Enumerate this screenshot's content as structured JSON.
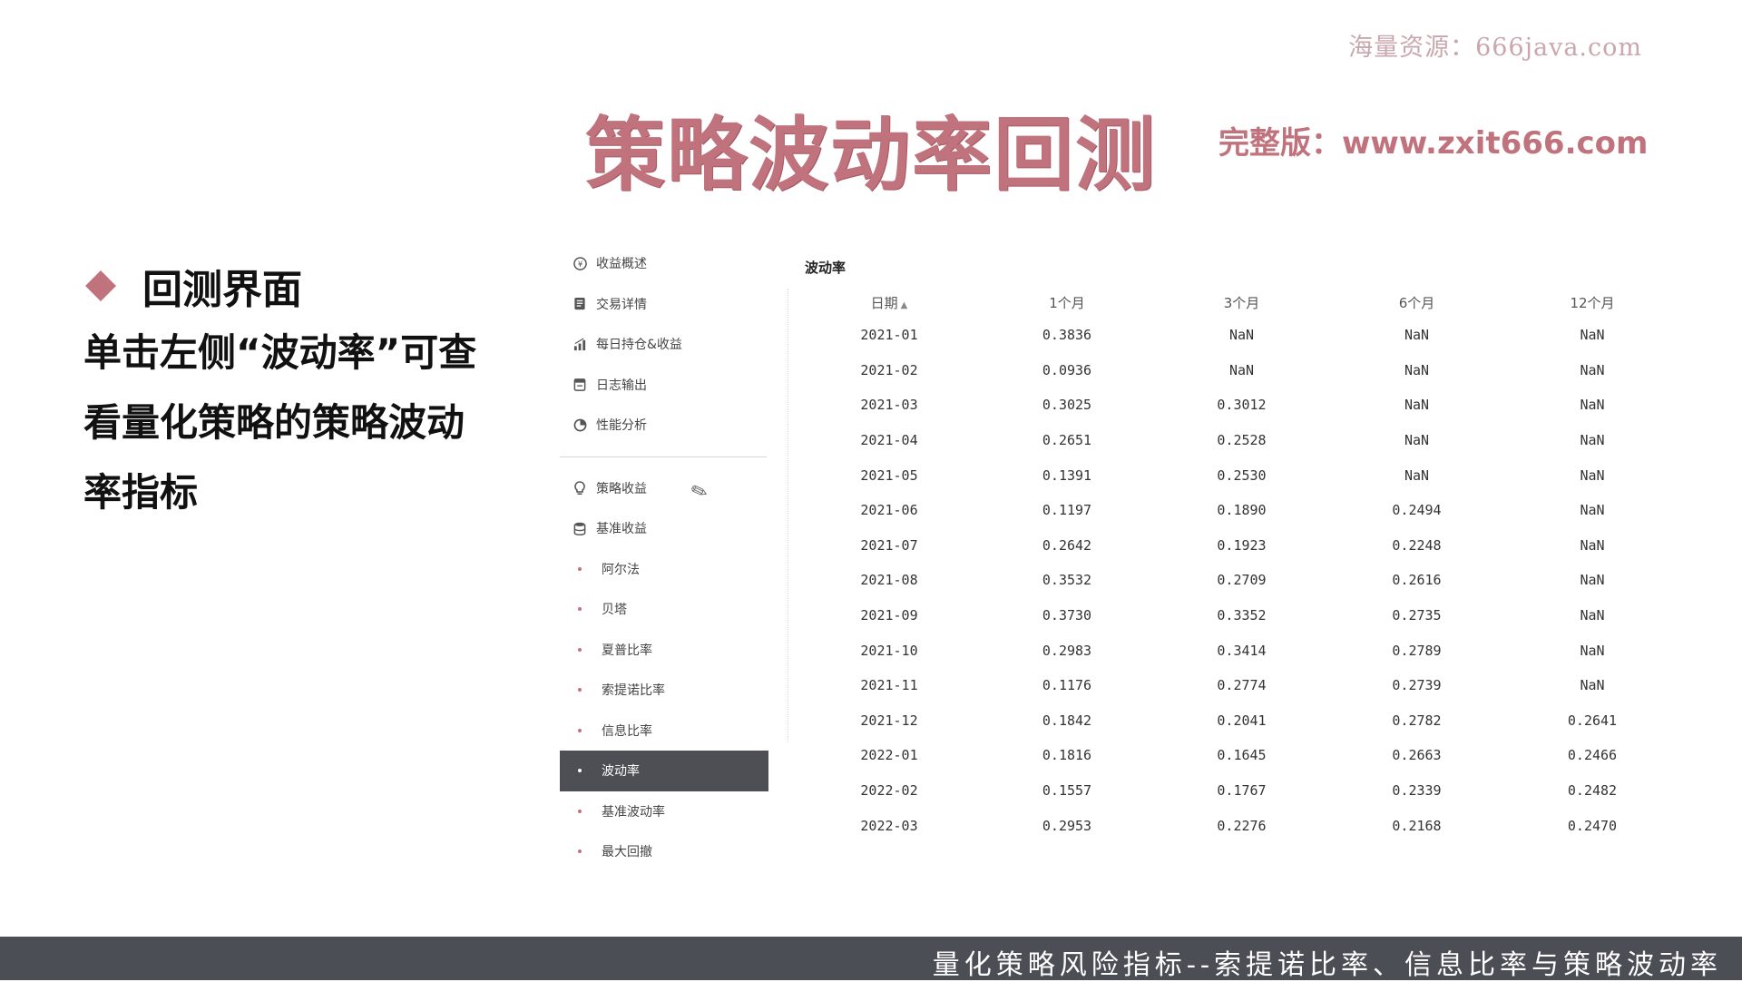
{
  "watermark": "海量资源：666java.com",
  "title": "策略波动率回测",
  "full_link": "完整版：www.zxit666.com",
  "heading": "回测界面",
  "description": "单击左侧“波动率”可查看量化策略的策略波动率指标",
  "sidebar": {
    "top_items": [
      {
        "label": "收益概述",
        "icon": "coin-icon"
      },
      {
        "label": "交易详情",
        "icon": "document-icon"
      },
      {
        "label": "每日持仓&收益",
        "icon": "bar-chart-icon"
      },
      {
        "label": "日志输出",
        "icon": "calendar-icon"
      },
      {
        "label": "性能分析",
        "icon": "pie-icon"
      }
    ],
    "bottom_items": [
      {
        "label": "策略收益",
        "icon": "lightbulb-icon"
      },
      {
        "label": "基准收益",
        "icon": "database-icon"
      },
      {
        "label": "阿尔法"
      },
      {
        "label": "贝塔"
      },
      {
        "label": "夏普比率"
      },
      {
        "label": "索提诺比率"
      },
      {
        "label": "信息比率"
      },
      {
        "label": "波动率",
        "active": true
      },
      {
        "label": "基准波动率"
      },
      {
        "label": "最大回撤"
      }
    ]
  },
  "table": {
    "title": "波动率",
    "columns": [
      "日期",
      "1个月",
      "3个月",
      "6个月",
      "12个月"
    ],
    "rows": [
      [
        "2021-01",
        "0.3836",
        "NaN",
        "NaN",
        "NaN"
      ],
      [
        "2021-02",
        "0.0936",
        "NaN",
        "NaN",
        "NaN"
      ],
      [
        "2021-03",
        "0.3025",
        "0.3012",
        "NaN",
        "NaN"
      ],
      [
        "2021-04",
        "0.2651",
        "0.2528",
        "NaN",
        "NaN"
      ],
      [
        "2021-05",
        "0.1391",
        "0.2530",
        "NaN",
        "NaN"
      ],
      [
        "2021-06",
        "0.1197",
        "0.1890",
        "0.2494",
        "NaN"
      ],
      [
        "2021-07",
        "0.2642",
        "0.1923",
        "0.2248",
        "NaN"
      ],
      [
        "2021-08",
        "0.3532",
        "0.2709",
        "0.2616",
        "NaN"
      ],
      [
        "2021-09",
        "0.3730",
        "0.3352",
        "0.2735",
        "NaN"
      ],
      [
        "2021-10",
        "0.2983",
        "0.3414",
        "0.2789",
        "NaN"
      ],
      [
        "2021-11",
        "0.1176",
        "0.2774",
        "0.2739",
        "NaN"
      ],
      [
        "2021-12",
        "0.1842",
        "0.2041",
        "0.2782",
        "0.2641"
      ],
      [
        "2022-01",
        "0.1816",
        "0.1645",
        "0.2663",
        "0.2466"
      ],
      [
        "2022-02",
        "0.1557",
        "0.1767",
        "0.2339",
        "0.2482"
      ],
      [
        "2022-03",
        "0.2953",
        "0.2276",
        "0.2168",
        "0.2470"
      ]
    ]
  },
  "footer": "量化策略风险指标--索提诺比率、信息比率与策略波动率",
  "colors": {
    "accent": "#c1737d",
    "footer_bg": "#4c4e55",
    "active_nav": "#4e4e55"
  }
}
